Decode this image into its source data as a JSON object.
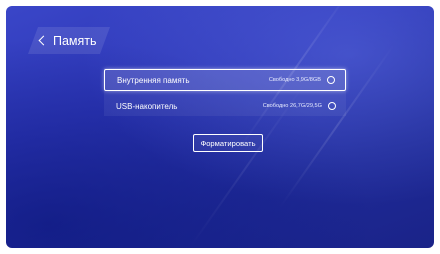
{
  "header": {
    "back_label": "Память"
  },
  "storage": {
    "items": [
      {
        "name": "Внутренняя память",
        "free": "Свободно 3,9G/8GB",
        "selected": true
      },
      {
        "name": "USB-накопитель",
        "free": "Свободно 26,7G/29,5G",
        "selected": false
      }
    ]
  },
  "actions": {
    "format_label": "Форматировать"
  },
  "colors": {
    "background": "#2c36b6",
    "text": "#ffffff"
  }
}
